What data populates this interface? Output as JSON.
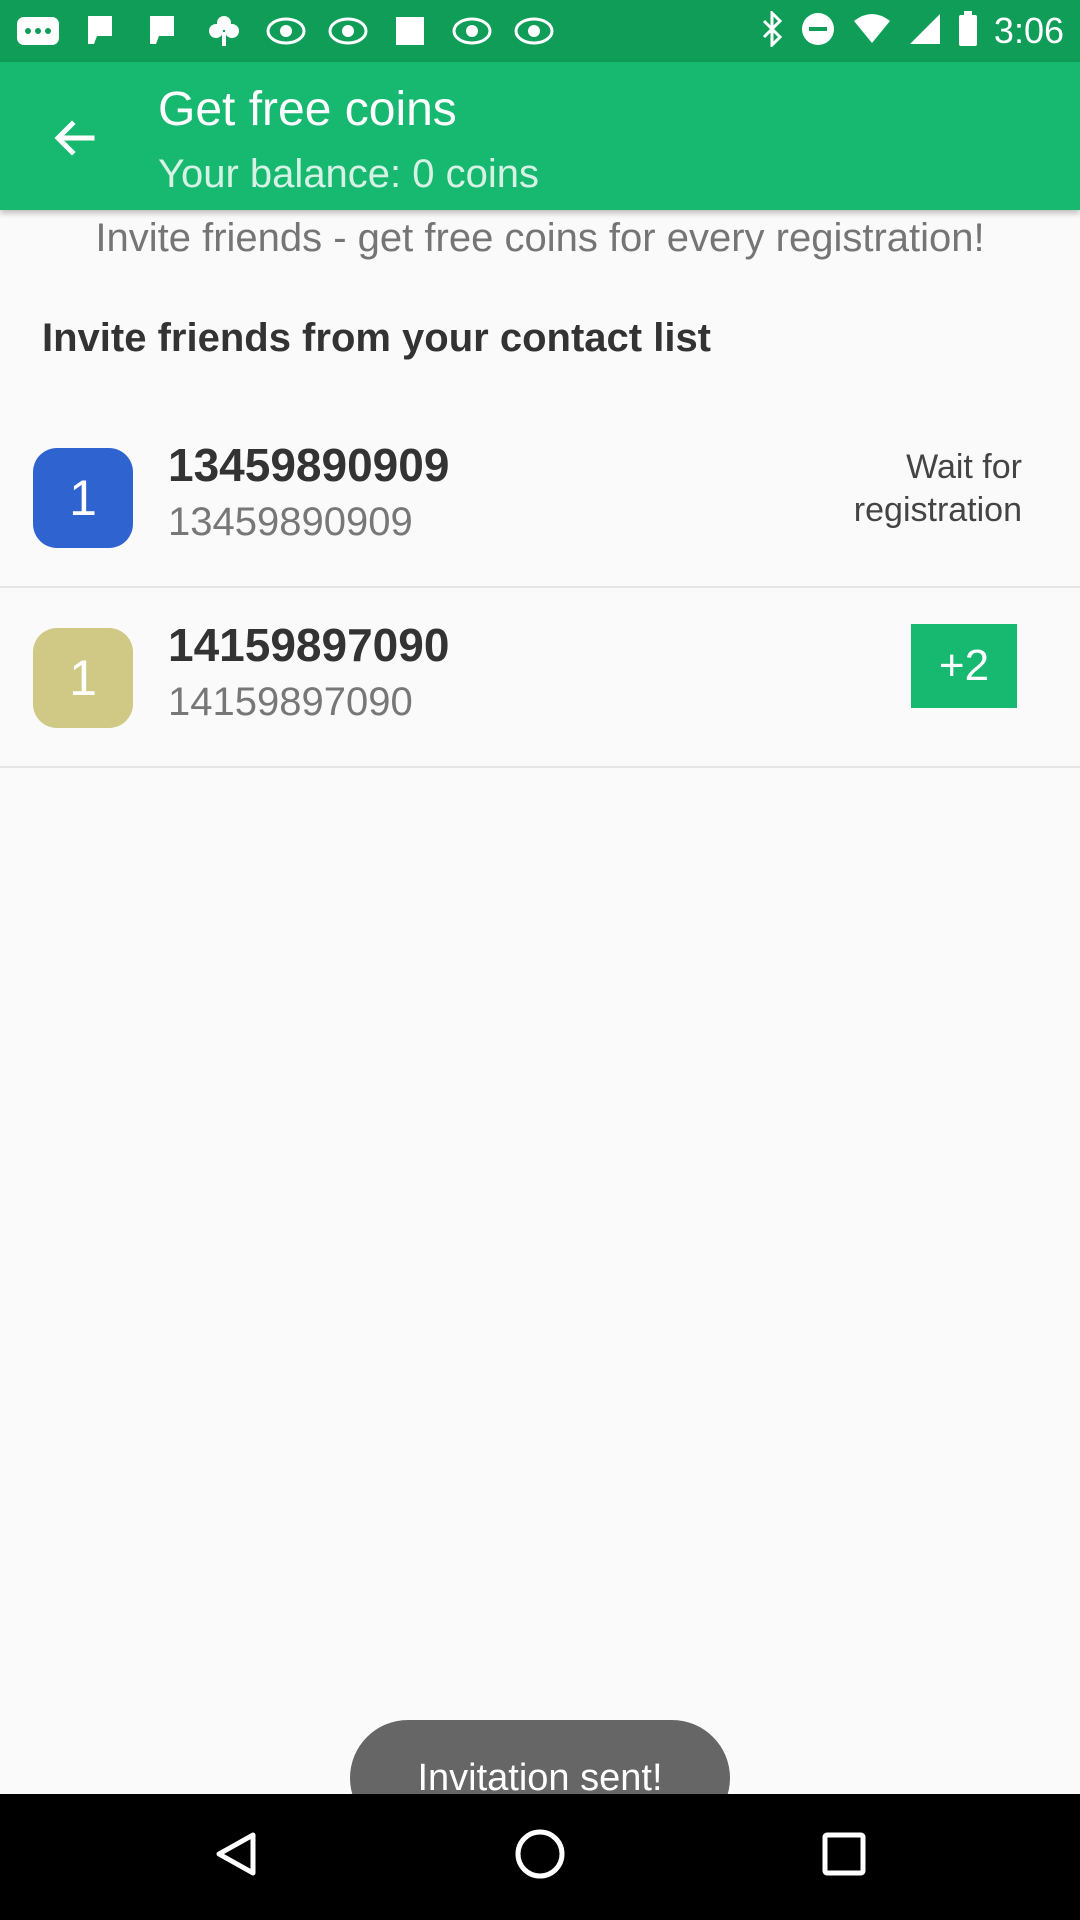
{
  "status_bar": {
    "time": "3:06",
    "icons": [
      "more-dots-icon",
      "flag-icon",
      "flag-icon",
      "clover-icon",
      "abc13-icon",
      "abc13-icon",
      "square-icon",
      "abc13-icon",
      "abc13-icon",
      "bluetooth-icon",
      "do-not-disturb-icon",
      "wifi-icon",
      "signal-icon",
      "battery-icon"
    ]
  },
  "app_bar": {
    "title": "Get free coins",
    "subtitle": "Your balance: 0 coins",
    "back_icon": "arrow-back-icon"
  },
  "intro_text": "Invite friends - get free coins for every registration!",
  "section_heading": "Invite friends from your contact list",
  "contacts": [
    {
      "badge": "1",
      "badge_color": "#2f63cf",
      "name": "13459890909",
      "phone": "13459890909",
      "status": "Wait for registration"
    },
    {
      "badge": "1",
      "badge_color": "#cfc985",
      "name": "14159897090",
      "phone": "14159897090",
      "action": "+2"
    }
  ],
  "toast": "Invitation sent!",
  "nav_bar": {
    "buttons": [
      "back-triangle-icon",
      "home-circle-icon",
      "recents-square-icon"
    ]
  },
  "colors": {
    "status_bar": "#0f9d58",
    "app_bar": "#17b86f",
    "accent": "#17b86f"
  }
}
